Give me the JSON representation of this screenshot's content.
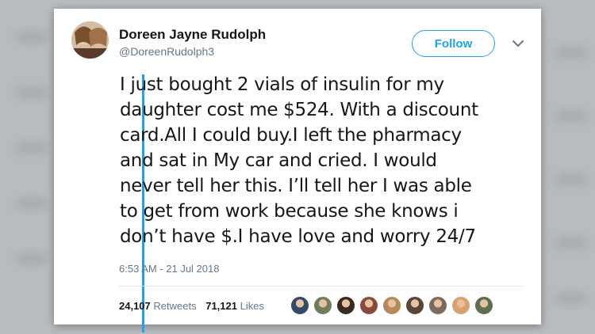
{
  "tweet": {
    "display_name": "Doreen Jayne Rudolph",
    "handle": "@DoreenRudolph3",
    "follow_label": "Follow",
    "text_lines": [
      "I just bought 2 vials of insulin for my",
      "daughter cost me $524. With a discount",
      "card.All I could buy.I left the pharmacy",
      "and sat in My car and cried. I would",
      "never tell her this. I’ll  tell her I was able",
      "to get from work because she knows i",
      "don’t have $.I have love and worry 24/7"
    ],
    "timestamp": "6:53 AM - 21 Jul 2018",
    "retweets": {
      "count": "24,107",
      "label": "Retweets"
    },
    "likes": {
      "count": "71,121",
      "label": "Likes"
    },
    "liker_avatar_colors": [
      "#2f4a6b",
      "#6f7d5a",
      "#3a2a20",
      "#8a4a3a",
      "#b38a5a",
      "#5a4638",
      "#7a6a5a",
      "#d9a070",
      "#5d6f4e"
    ]
  },
  "colors": {
    "accent": "#1da1f2",
    "text": "#14171a",
    "muted": "#657786"
  },
  "icons": {
    "avatar": "profile-photo",
    "menu": "chevron-down-icon"
  }
}
